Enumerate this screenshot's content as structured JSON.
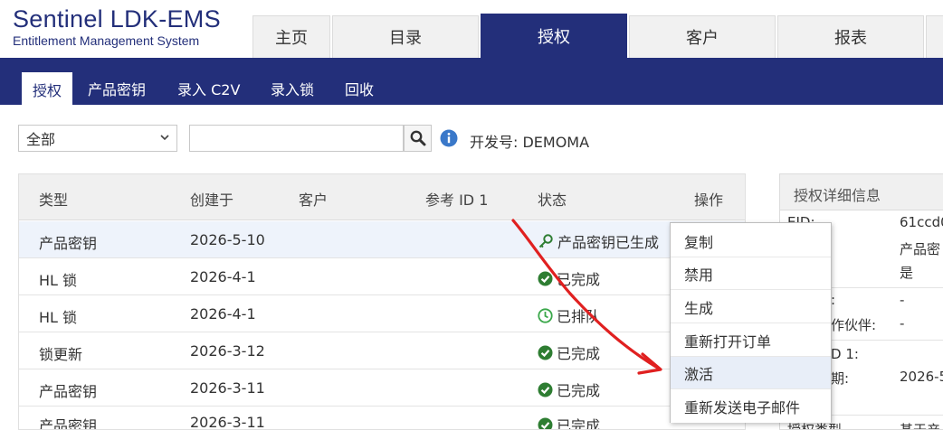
{
  "app": {
    "logo_title": "Sentinel LDK-EMS",
    "logo_subtitle": "Entitlement Management System"
  },
  "tabs": [
    "主页",
    "目录",
    "授权",
    "客户",
    "报表"
  ],
  "subnav": [
    "授权",
    "产品密钥",
    "录入 C2V",
    "录入锁",
    "回收"
  ],
  "filter": {
    "selected": "全部",
    "search_value": "",
    "developer_label": "开发号: DEMOMA"
  },
  "table": {
    "headers": [
      "类型",
      "创建于",
      "客户",
      "参考 ID 1",
      "状态",
      "操作"
    ],
    "rows": [
      {
        "type": "产品密钥",
        "created": "2026-5-10",
        "status": "产品密钥已生成",
        "status_icon": "key-icon"
      },
      {
        "type": "HL 锁",
        "created": "2026-4-1",
        "status": "已完成",
        "status_icon": "check-circle-icon"
      },
      {
        "type": "HL 锁",
        "created": "2026-4-1",
        "status": "已排队",
        "status_icon": "clock-icon"
      },
      {
        "type": "锁更新",
        "created": "2026-3-12",
        "status": "已完成",
        "status_icon": "check-circle-icon"
      },
      {
        "type": "产品密钥",
        "created": "2026-3-11",
        "status": "已完成",
        "status_icon": "check-circle-icon"
      },
      {
        "type": "产品密钥",
        "created": "2026-3-11",
        "status": "已完成",
        "status_icon": "check-circle-icon"
      }
    ]
  },
  "menu": {
    "items": [
      "复制",
      "禁用",
      "生成",
      "重新打开订单",
      "激活",
      "重新发送电子邮件"
    ]
  },
  "details": {
    "title": "授权详细信息",
    "lines": [
      "EID:",
      "61ccd0",
      "产品密",
      "是",
      ":",
      "-",
      "作伙伴:",
      "-",
      "D 1:",
      "期:",
      "2026-5",
      "授权类型",
      "基于产"
    ]
  },
  "colors": {
    "brand": "#232f7a",
    "success": "#2e7d32",
    "queued": "#3aa74a",
    "annotation_arrow": "#e02020"
  }
}
